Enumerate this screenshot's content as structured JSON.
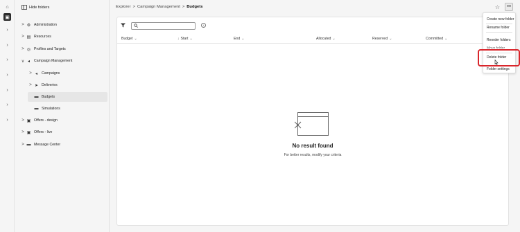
{
  "tree": {
    "hide_label": "Hide folders",
    "items": [
      {
        "label": "Administration",
        "chevron": ">",
        "icon": "admin-icon",
        "glyph": "⚙"
      },
      {
        "label": "Resources",
        "chevron": ">",
        "icon": "resources-icon",
        "glyph": "▤"
      },
      {
        "label": "Profiles and Targets",
        "chevron": ">",
        "icon": "target-icon",
        "glyph": "◎"
      },
      {
        "label": "Campaign Management",
        "chevron": "∨",
        "icon": "megaphone-icon",
        "glyph": "◂"
      },
      {
        "label": "Campaigns",
        "chevron": ">",
        "icon": "megaphone-icon",
        "glyph": "◂"
      },
      {
        "label": "Deliveries",
        "chevron": ">",
        "icon": "send-icon",
        "glyph": "➤"
      },
      {
        "label": "Budgets",
        "chevron": "",
        "icon": "folder-icon",
        "glyph": "▬"
      },
      {
        "label": "Simulations",
        "chevron": "",
        "icon": "folder-icon",
        "glyph": "▬"
      },
      {
        "label": "Offers - design",
        "chevron": ">",
        "icon": "offer-icon",
        "glyph": "▣"
      },
      {
        "label": "Offers - live",
        "chevron": ">",
        "icon": "offer-icon",
        "glyph": "▣"
      },
      {
        "label": "Message Center",
        "chevron": ">",
        "icon": "folder-icon",
        "glyph": "▬"
      }
    ]
  },
  "breadcrumb": {
    "items": [
      "Explorer",
      "Campaign Management"
    ],
    "separator": ">",
    "current": "Budgets"
  },
  "table": {
    "search_placeholder": "",
    "columns": [
      "Budget",
      "Start",
      "End",
      "Allocated",
      "Reserved",
      "Committed"
    ]
  },
  "empty": {
    "title": "No result found",
    "subtitle": "For better results, modify your criteria"
  },
  "menu": {
    "items": [
      "Create new folder",
      "Rename folder",
      "Reorder folders",
      "Move folder",
      "Delete folder",
      "Folder settings"
    ]
  },
  "colors": {
    "highlight": "#d9252b",
    "rail_active": "#2c2c2c"
  }
}
